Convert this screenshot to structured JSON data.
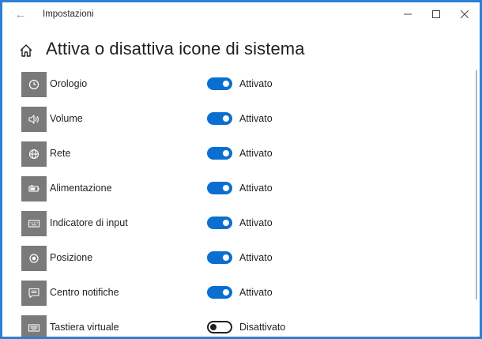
{
  "window": {
    "title": "Impostazioni"
  },
  "page": {
    "title": "Attiva o disattiva icone di sistema"
  },
  "rows": [
    {
      "label": "Orologio",
      "icon": "clock-icon",
      "enabled": true,
      "state": "Attivato"
    },
    {
      "label": "Volume",
      "icon": "volume-icon",
      "enabled": true,
      "state": "Attivato"
    },
    {
      "label": "Rete",
      "icon": "network-globe-icon",
      "enabled": true,
      "state": "Attivato"
    },
    {
      "label": "Alimentazione",
      "icon": "battery-icon",
      "enabled": true,
      "state": "Attivato"
    },
    {
      "label": "Indicatore di input",
      "icon": "keyboard-icon",
      "enabled": true,
      "state": "Attivato"
    },
    {
      "label": "Posizione",
      "icon": "location-icon",
      "enabled": true,
      "state": "Attivato"
    },
    {
      "label": "Centro notifiche",
      "icon": "notification-center-icon",
      "enabled": true,
      "state": "Attivato"
    },
    {
      "label": "Tastiera virtuale",
      "icon": "touch-keyboard-icon",
      "enabled": false,
      "state": "Disattivato"
    }
  ],
  "colors": {
    "accent": "#0a6fd0",
    "tile": "#7a7a7a",
    "frame": "#2d7fd3"
  }
}
